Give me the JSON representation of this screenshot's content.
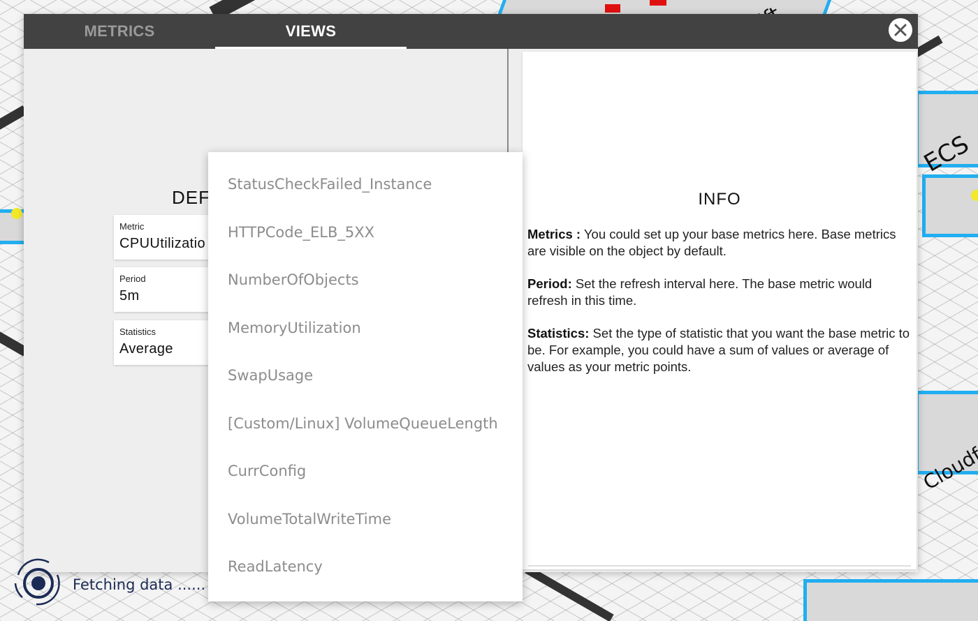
{
  "scene": {
    "labels": [
      "ECS",
      "Cloudfr",
      "ift"
    ]
  },
  "modal": {
    "tabs": [
      {
        "label": "METRICS",
        "active": false
      },
      {
        "label": "VIEWS",
        "active": true
      }
    ],
    "close_icon": "close-icon"
  },
  "settings": {
    "title": "DEF",
    "metric": {
      "label": "Metric",
      "value": "CPUUtilizatio"
    },
    "period": {
      "label": "Period",
      "value": "5m"
    },
    "statistics": {
      "label": "Statistics",
      "value": "Average"
    }
  },
  "dropdown": {
    "items": [
      "StatusCheckFailed_Instance",
      "HTTPCode_ELB_5XX",
      "NumberOfObjects",
      "MemoryUtilization",
      "SwapUsage",
      "[Custom/Linux] VolumeQueueLength",
      "CurrConfig",
      "VolumeTotalWriteTime",
      "ReadLatency"
    ]
  },
  "info": {
    "title": "INFO",
    "metrics_term": "Metrics :",
    "metrics_text": " You could set up your base metrics here. Base metrics are visible on the object by default.",
    "period_term": "Period:",
    "period_text": " Set the refresh interval here. The base metric would refresh in this time.",
    "statistics_term": "Statistics:",
    "statistics_text": " Set the type of statistic that you want the base metric to be. For example, you could have a sum of values or average of values as your metric points."
  },
  "status": {
    "text": "Fetching data ......"
  },
  "colors": {
    "tab_bar": "#424242",
    "accent_blue": "#22aef0",
    "loader": "#1c2b55"
  }
}
